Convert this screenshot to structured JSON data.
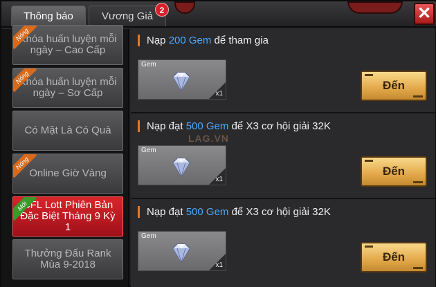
{
  "tabs": [
    {
      "label": "Thông báo",
      "active": true
    },
    {
      "label": "Vương Giả",
      "active": false,
      "badge": "2"
    }
  ],
  "close_label": "✕",
  "sidebar": {
    "items": [
      {
        "label": "Khóa huấn luyện mỗi ngày – Cao Cấp",
        "ribbon": "Nóng",
        "ribbon_color": "orange",
        "active": false
      },
      {
        "label": "Khóa huấn luyện mỗi ngày – Sơ Cấp",
        "ribbon": "Nóng",
        "ribbon_color": "orange",
        "active": false
      },
      {
        "label": "Có Mặt Là Có Quà",
        "ribbon": "",
        "active": false
      },
      {
        "label": "Online Giờ Vàng",
        "ribbon": "Nóng",
        "ribbon_color": "orange",
        "active": false
      },
      {
        "label": "CFL Lott Phiên Bản Đặc Biệt Tháng 9 Kỳ 1",
        "ribbon": "Mới",
        "ribbon_color": "green",
        "active": true
      },
      {
        "label": "Thưởng Đấu Rank Mùa 9-2018",
        "ribbon": "",
        "active": false
      }
    ]
  },
  "rewards": [
    {
      "prefix": "Nạp ",
      "gem_amount": "200 Gem",
      "suffix": " để tham gia",
      "card_label": "Gem",
      "count": "x1",
      "button": "Đến"
    },
    {
      "prefix": "Nạp đạt ",
      "gem_amount": "500 Gem",
      "suffix": " để X3 cơ hội giải 32K",
      "card_label": "Gem",
      "count": "x1",
      "button": "Đến"
    },
    {
      "prefix": "Nạp đạt ",
      "gem_amount": "500 Gem",
      "suffix": " để X3 cơ hội giải 32K",
      "card_label": "Gem",
      "count": "x1",
      "button": "Đến"
    }
  ],
  "watermark": "LAG.VN",
  "colors": {
    "accent_blue": "#4aa8ff",
    "active_red": "#c81a22",
    "button_gold": "#e3a84a",
    "badge_red": "#d8202a"
  },
  "icons": {
    "gem": "diamond-icon",
    "close": "close-icon"
  }
}
